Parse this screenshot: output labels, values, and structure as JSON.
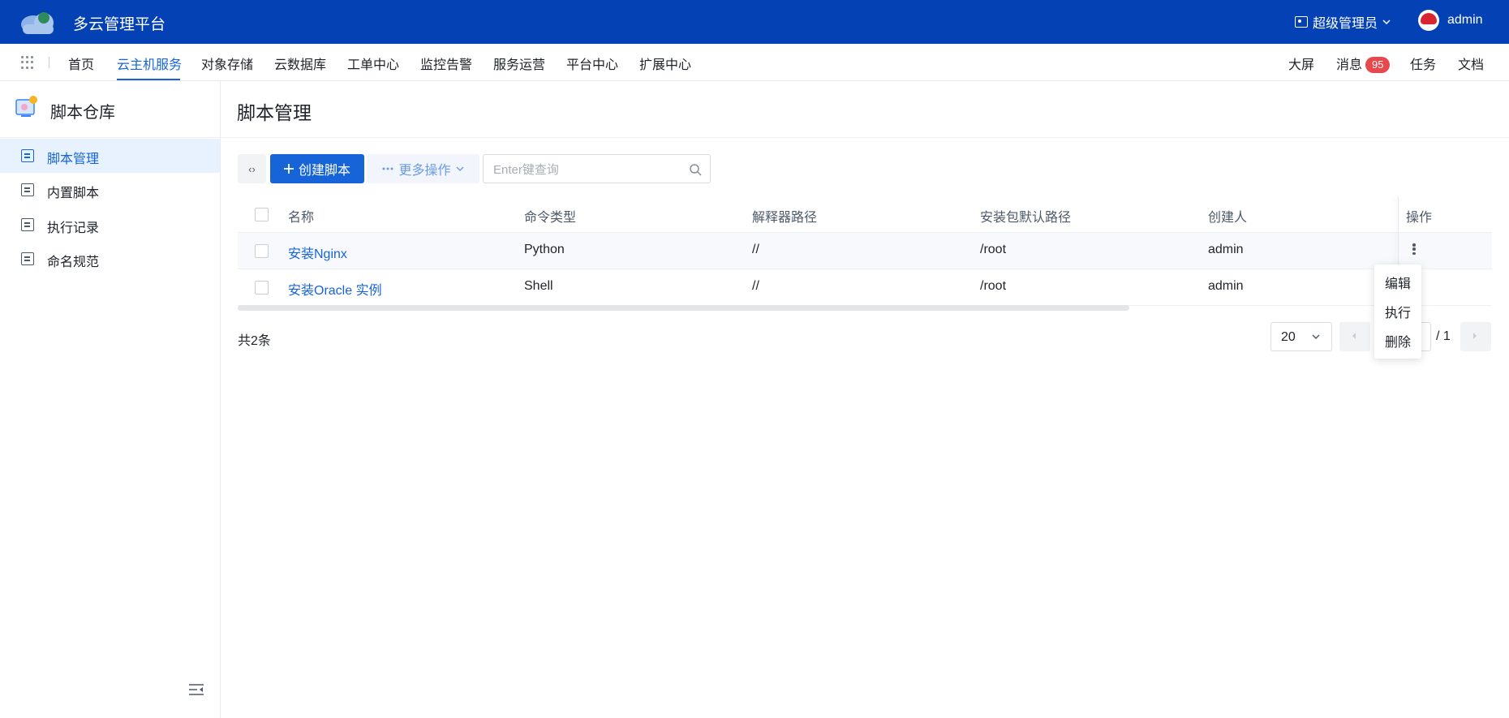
{
  "app": {
    "title": "多云管理平台"
  },
  "header": {
    "role": "超级管理员",
    "user": "admin"
  },
  "nav": {
    "items": [
      {
        "label": "首页"
      },
      {
        "label": "云主机服务"
      },
      {
        "label": "对象存储"
      },
      {
        "label": "云数据库"
      },
      {
        "label": "工单中心"
      },
      {
        "label": "监控告警"
      },
      {
        "label": "服务运营"
      },
      {
        "label": "平台中心"
      },
      {
        "label": "扩展中心"
      }
    ],
    "active": "云主机服务",
    "right": {
      "screen": "大屏",
      "messages": "消息",
      "messages_count": "95",
      "tasks": "任务",
      "docs": "文档"
    }
  },
  "sidebar": {
    "title": "脚本仓库",
    "items": [
      {
        "label": "脚本管理",
        "icon": "code-file-icon"
      },
      {
        "label": "内置脚本",
        "icon": "builtin-script-icon"
      },
      {
        "label": "执行记录",
        "icon": "record-icon"
      },
      {
        "label": "命名规范",
        "icon": "naming-rule-icon"
      }
    ],
    "active": "脚本管理"
  },
  "page": {
    "title": "脚本管理"
  },
  "toolbar": {
    "refresh": "‹›",
    "create_label": "创建脚本",
    "more_label": "更多操作",
    "search_placeholder": "Enter键查询"
  },
  "table": {
    "columns": [
      "名称",
      "命令类型",
      "解释器路径",
      "安装包默认路径",
      "创建人",
      "操作"
    ],
    "rows": [
      {
        "name": "安装Nginx",
        "type": "Python",
        "interpreter": "//",
        "install_path": "/root",
        "creator": "admin"
      },
      {
        "name": "安装Oracle 实例",
        "type": "Shell",
        "interpreter": "//",
        "install_path": "/root",
        "creator": "admin"
      }
    ]
  },
  "row_menu": {
    "items": [
      "编辑",
      "执行",
      "删除"
    ]
  },
  "pagination": {
    "total_text": "共2条",
    "page_size": "20",
    "total_pages_text": "/ 1"
  },
  "colors": {
    "topbar": "#0441b5",
    "accent": "#1664d8",
    "badge": "#e8484c"
  }
}
